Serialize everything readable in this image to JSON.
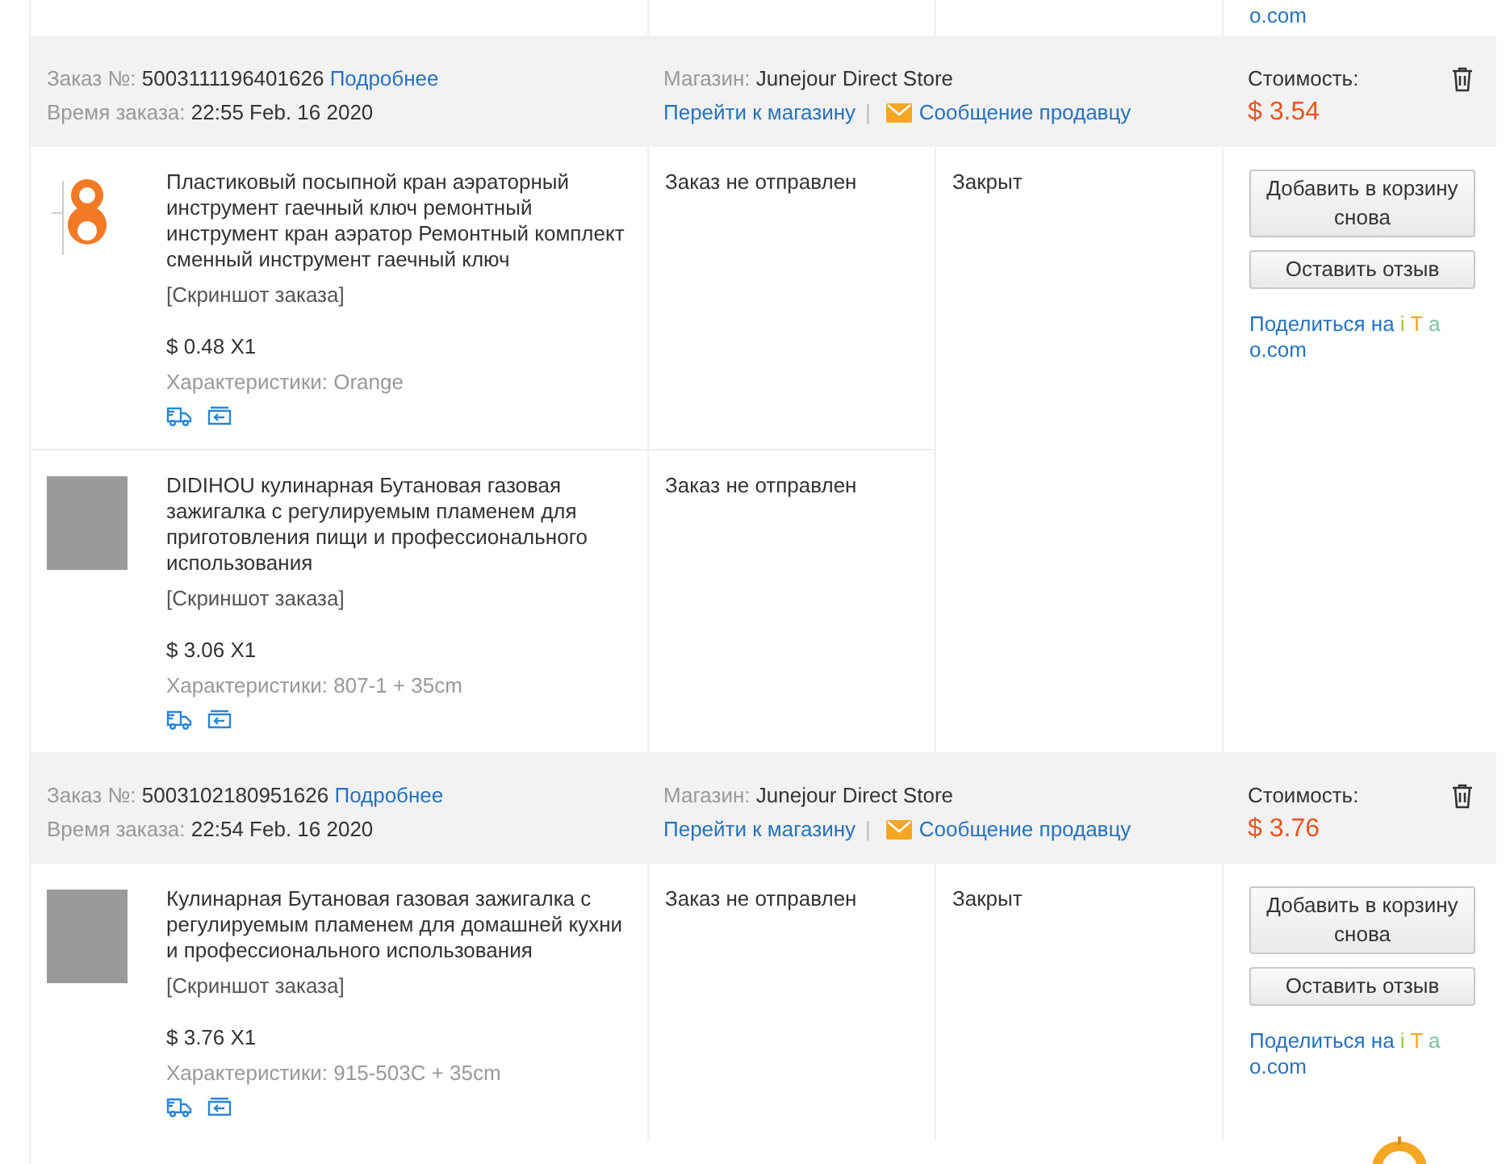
{
  "previous_order": {
    "share_tail": "o.com"
  },
  "orders": [
    {
      "number_label": "Заказ №:",
      "number": "5003111196401626",
      "details_link": "Подробнее",
      "time_label": "Время заказа:",
      "time": "22:55 Feb. 16 2020",
      "store_label": "Магазин:",
      "store": "Junejour Direct Store",
      "store_link": "Перейти к магазину",
      "separator": "|",
      "message_link": "Сообщение продавцу",
      "cost_label": "Стоимость:",
      "cost": "$ 3.54",
      "order_state": "Закрыт",
      "buttons": [
        "Добавить в корзину снова",
        "Оставить отзыв"
      ],
      "share": {
        "prefix": "Поделиться на",
        "letters": [
          {
            "text": "i",
            "color": "#9bc53d"
          },
          {
            "text": "T",
            "color": "#f5a623"
          },
          {
            "text": "a",
            "color": "#7cc4a0"
          }
        ],
        "tail": "o.com"
      },
      "items": [
        {
          "kind": "wrench",
          "title": "Пластиковый посыпной кран аэраторный инструмент гаечный ключ ремонтный инструмент кран аэратор Ремонтный комплект сменный инструмент гаечный ключ",
          "snapshot": "[Скриншот заказа]",
          "price": "$ 0.48 X1",
          "specs": "Характеристики: Orange",
          "status": "Заказ не отправлен"
        },
        {
          "kind": "photo",
          "title": "DIDIHOU кулинарная Бутановая газовая зажигалка с регулируемым пламенем для приготовления пищи и профессионального использования",
          "snapshot": "[Скриншот заказа]",
          "price": "$ 3.06 X1",
          "specs": "Характеристики: 807-1 + 35cm",
          "status": "Заказ не отправлен"
        }
      ]
    },
    {
      "number_label": "Заказ №:",
      "number": "5003102180951626",
      "details_link": "Подробнее",
      "time_label": "Время заказа:",
      "time": "22:54 Feb. 16 2020",
      "store_label": "Магазин:",
      "store": "Junejour Direct Store",
      "store_link": "Перейти к магазину",
      "separator": "|",
      "message_link": "Сообщение продавцу",
      "cost_label": "Стоимость:",
      "cost": "$ 3.76",
      "order_state": "Закрыт",
      "buttons": [
        "Добавить в корзину снова",
        "Оставить отзыв"
      ],
      "share": {
        "prefix": "Поделиться на",
        "letters": [
          {
            "text": "i",
            "color": "#9bc53d"
          },
          {
            "text": "T",
            "color": "#f5a623"
          },
          {
            "text": "a",
            "color": "#7cc4a0"
          }
        ],
        "tail": "o.com"
      },
      "items": [
        {
          "kind": "photo",
          "title": "Кулинарная Бутановая газовая зажигалка с регулируемым пламенем для домашней кухни и профессионального использования",
          "snapshot": "[Скриншот заказа]",
          "price": "$ 3.76 X1",
          "specs": "Характеристики: 915-503C + 35cm",
          "status": "Заказ не отправлен"
        }
      ]
    }
  ]
}
